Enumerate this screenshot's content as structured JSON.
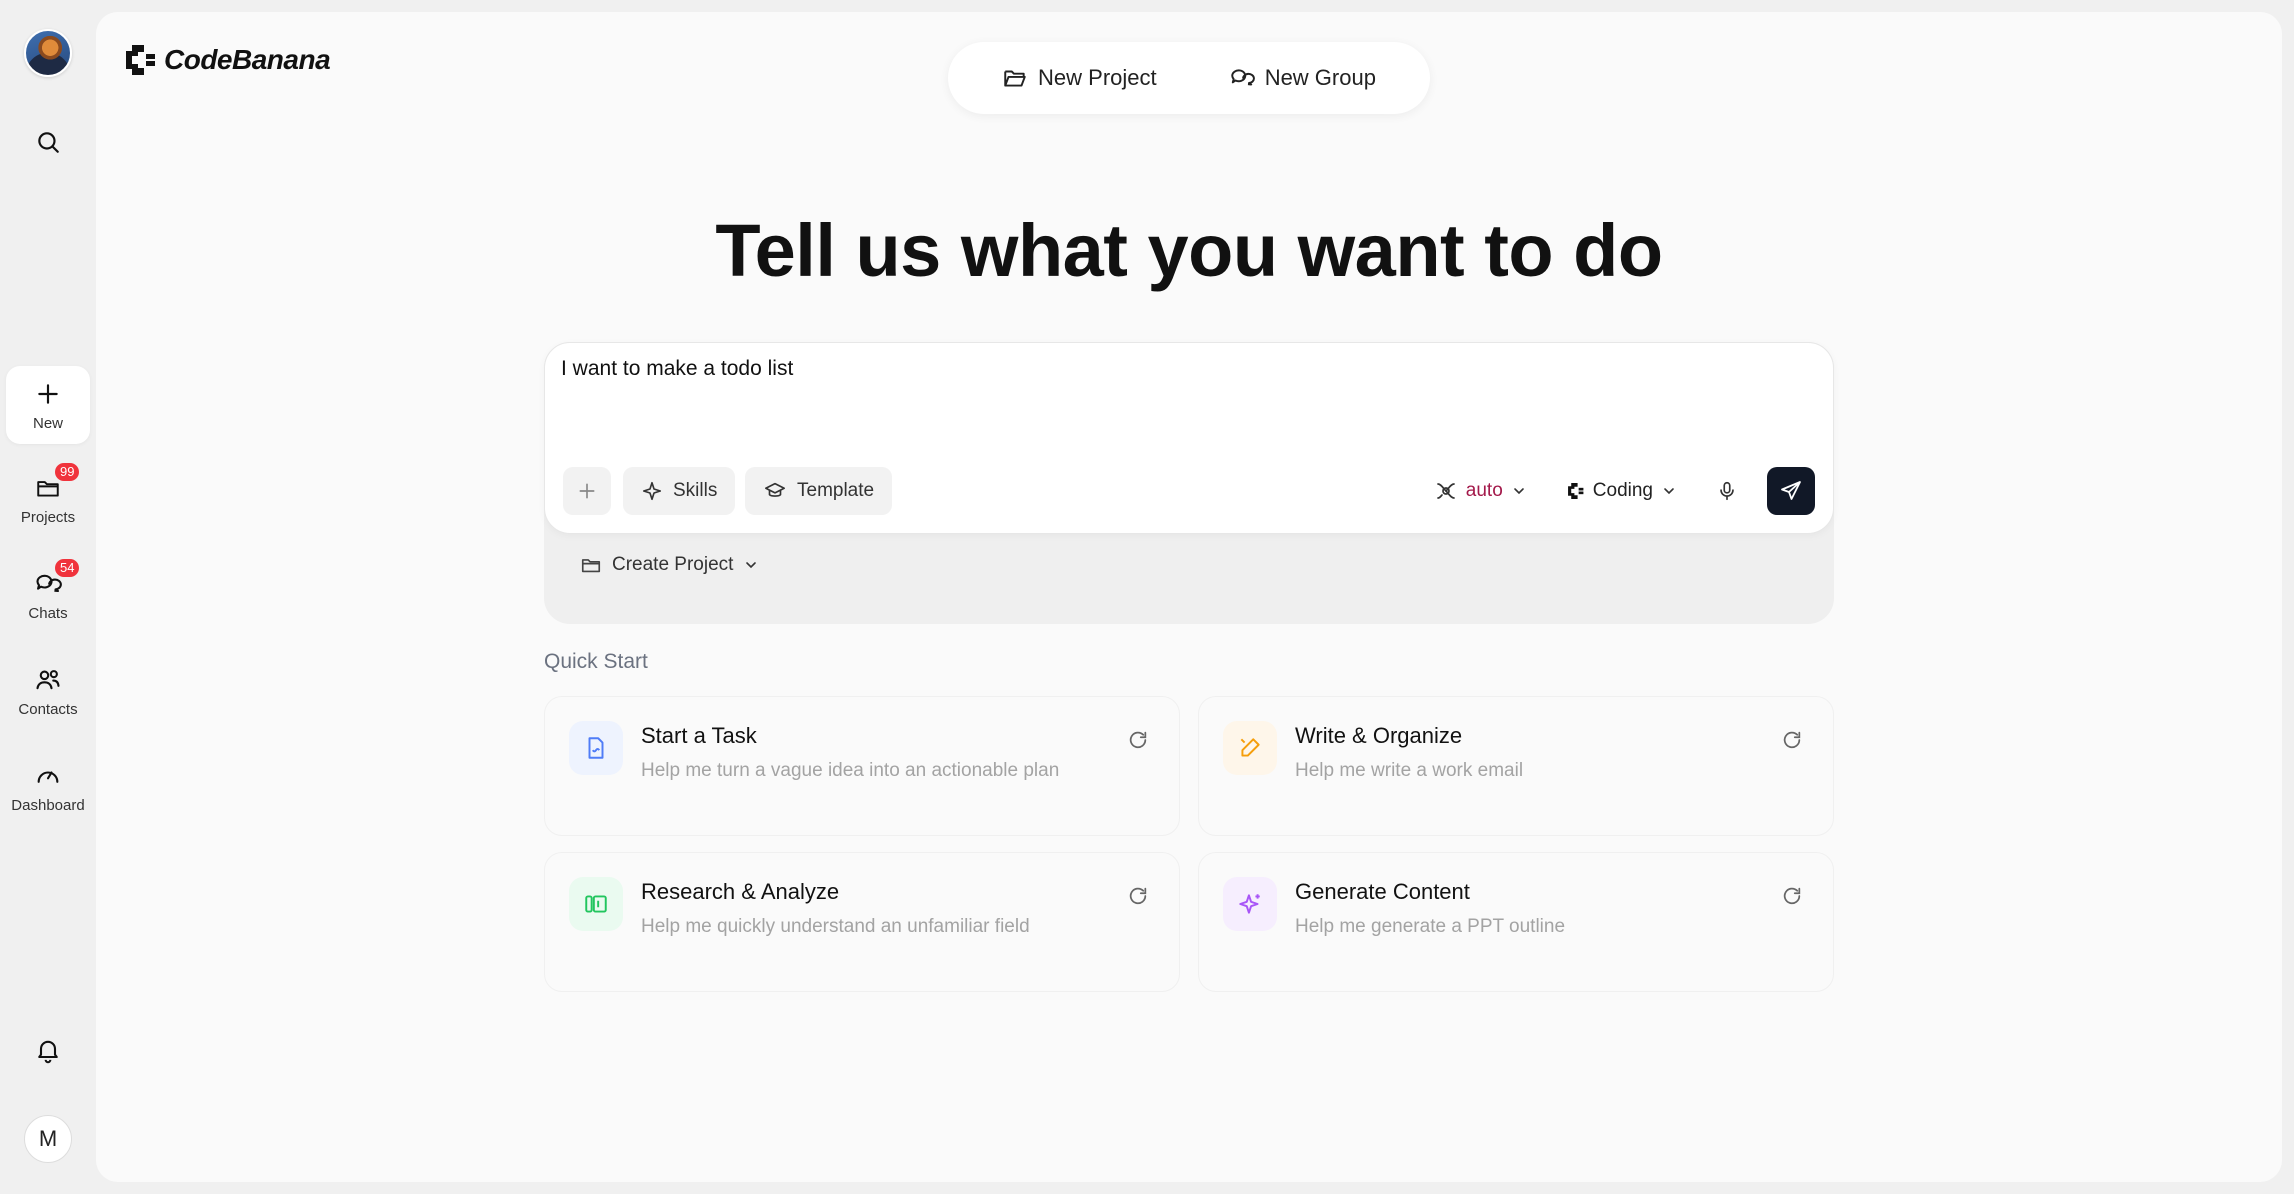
{
  "app": {
    "name": "CodeBanana"
  },
  "sidebar": {
    "items": [
      {
        "key": "new",
        "label": "New",
        "icon": "plus-icon",
        "active": true
      },
      {
        "key": "projects",
        "label": "Projects",
        "icon": "folder-icon",
        "badge": "99"
      },
      {
        "key": "chats",
        "label": "Chats",
        "icon": "chat-icon",
        "badge": "54"
      },
      {
        "key": "contacts",
        "label": "Contacts",
        "icon": "contacts-icon"
      },
      {
        "key": "dashboard",
        "label": "Dashboard",
        "icon": "gauge-icon"
      }
    ],
    "user_initial": "M"
  },
  "top_switch": {
    "new_project": "New Project",
    "new_group": "New Group"
  },
  "hero": {
    "title": "Tell us what you want to do"
  },
  "composer": {
    "input_value": "I want to make a todo list",
    "skills_label": "Skills",
    "template_label": "Template",
    "model_select": "auto",
    "mode_select": "Coding",
    "create_project_label": "Create Project"
  },
  "quick_start": {
    "title": "Quick Start",
    "cards": [
      {
        "title": "Start a Task",
        "subtitle": "Help me turn a vague idea into an actionable plan",
        "icon": "task-doc-icon",
        "color": "#4f7cf7",
        "bg": "#eef3fe"
      },
      {
        "title": "Write & Organize",
        "subtitle": "Help me write a work email",
        "icon": "pen-edit-icon",
        "color": "#f59e0b",
        "bg": "#fef6ea"
      },
      {
        "title": "Research & Analyze",
        "subtitle": "Help me quickly understand an unfamiliar field",
        "icon": "columns-icon",
        "color": "#22c55e",
        "bg": "#eafaf0"
      },
      {
        "title": "Generate Content",
        "subtitle": "Help me generate a PPT outline",
        "icon": "sparkle-icon",
        "color": "#a855f7",
        "bg": "#f6eefe"
      }
    ]
  },
  "colors": {
    "send_bg": "#111827",
    "badge": "#f0333c",
    "auto_accent": "#a3194a"
  }
}
